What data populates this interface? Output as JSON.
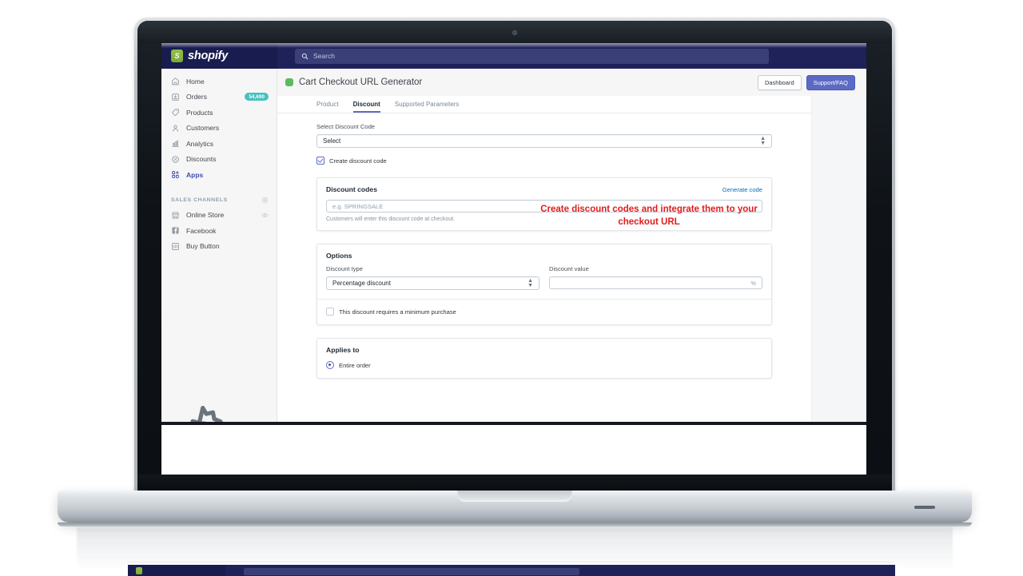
{
  "brand": {
    "name": "shopify",
    "logo_icon": "shopify-bag-icon",
    "nav_bg": "#1f2259"
  },
  "search": {
    "placeholder": "Search",
    "value": "",
    "icon": "search-icon"
  },
  "sidebar": {
    "items": [
      {
        "label": "Home",
        "icon": "home-icon",
        "badge": ""
      },
      {
        "label": "Orders",
        "icon": "orders-inbox-icon",
        "badge": "54,690"
      },
      {
        "label": "Products",
        "icon": "tag-icon",
        "badge": ""
      },
      {
        "label": "Customers",
        "icon": "person-icon",
        "badge": ""
      },
      {
        "label": "Analytics",
        "icon": "bar-chart-icon",
        "badge": ""
      },
      {
        "label": "Discounts",
        "icon": "discount-percent-icon",
        "badge": ""
      },
      {
        "label": "Apps",
        "icon": "apps-grid-plus-icon",
        "badge": "",
        "active": true
      }
    ],
    "sales_channels": {
      "title": "SALES CHANNELS",
      "add_icon": "plus-circle-icon",
      "items": [
        {
          "label": "Online Store",
          "icon": "storefront-icon",
          "trailing_icon": "eye-icon"
        },
        {
          "label": "Facebook",
          "icon": "facebook-icon"
        },
        {
          "label": "Buy Button",
          "icon": "code-brackets-icon"
        }
      ]
    },
    "settings": {
      "label": "Settings",
      "icon": "gear-icon"
    }
  },
  "app_header": {
    "status_icon": "app-green-dot-icon",
    "title": "Cart Checkout URL Generator",
    "dashboard_button": "Dashboard",
    "support_button": "Support/FAQ",
    "primary_color": "#5c6ac4"
  },
  "tabs": [
    {
      "label": "Product",
      "active": false
    },
    {
      "label": "Discount",
      "active": true
    },
    {
      "label": "Supported Parameters",
      "active": false
    }
  ],
  "discount_form": {
    "select_label": "Select Discount Code",
    "select_value": "Select",
    "select_stepper_icon": "up-down-chevron-icon",
    "create_checkbox": {
      "label": "Create discount code",
      "checked": true
    }
  },
  "annotation": {
    "text": "Create discount codes and integrate them to your checkout URL",
    "color": "#e01c1c"
  },
  "discount_codes_card": {
    "title": "Discount codes",
    "generate_link": "Generate code",
    "code_placeholder": "e.g. SPRINGSALE",
    "code_value": "",
    "help_text": "Customers will enter this discount code at checkout."
  },
  "options_card": {
    "title": "Options",
    "discount_type_label": "Discount type",
    "discount_type_value": "Percentage discount",
    "discount_value_label": "Discount value",
    "discount_value": "",
    "discount_value_suffix": "%",
    "minimum_purchase_checkbox": {
      "label": "This discount requires a minimum purchase",
      "checked": false
    }
  },
  "applies_to_card": {
    "title": "Applies to",
    "options": [
      {
        "label": "Entire order",
        "selected": true
      }
    ]
  }
}
